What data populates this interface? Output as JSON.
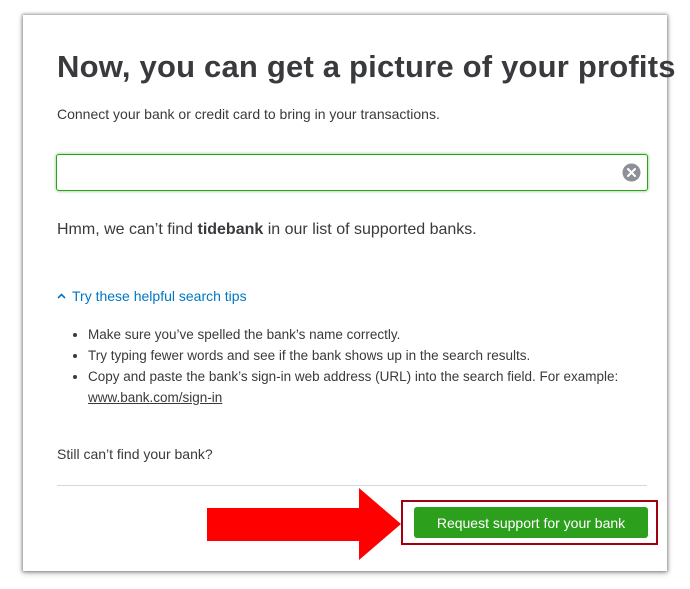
{
  "dialog": {
    "title": "Now, you can get a picture of your profits",
    "subtitle": "Connect your bank or credit card to bring in your transactions."
  },
  "search": {
    "value": "",
    "placeholder": "",
    "clear_icon": "clear-circle-x-icon"
  },
  "message": {
    "prefix": "Hmm, we can’t find ",
    "bank_name": "tidebank",
    "suffix": " in our list of supported banks."
  },
  "tips": {
    "toggle_label": "Try these helpful search tips",
    "toggle_icon": "chevron-up-icon",
    "items": [
      "Make sure you’ve spelled the bank’s name correctly.",
      "Try typing fewer words and see if the bank shows up in the search results.",
      "Copy and paste the bank’s sign-in web address (URL) into the search field. For example: "
    ],
    "example_link": "www.bank.com/sign-in"
  },
  "footer": {
    "still_cant_find": "Still can’t find your bank?",
    "request_button": "Request support for your bank"
  },
  "colors": {
    "accent_green": "#2ca01c",
    "link_blue": "#0077c5",
    "annotation_red": "#ff0000",
    "highlight_border": "#a3000f",
    "text": "#393a3d"
  }
}
